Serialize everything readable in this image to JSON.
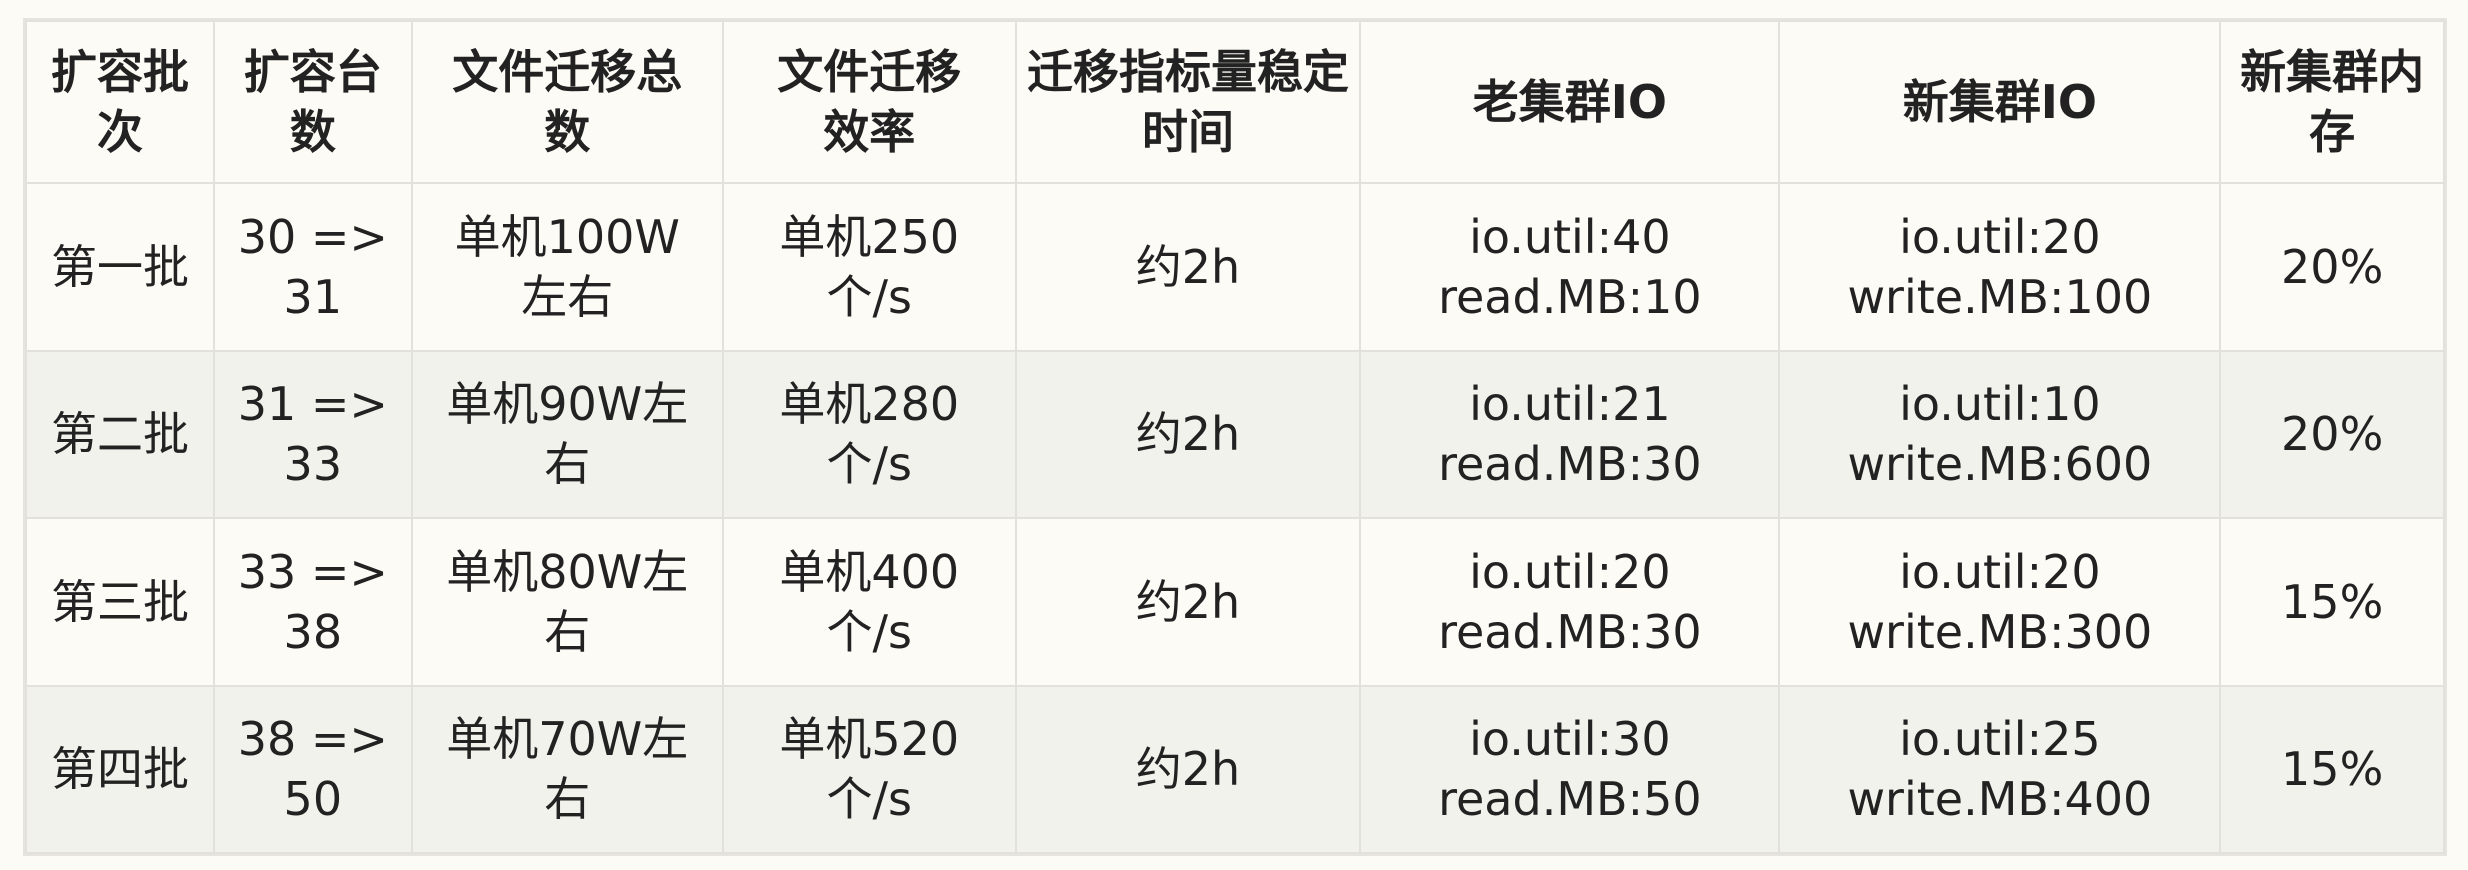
{
  "columns": [
    {
      "label": [
        "扩容批",
        "次"
      ]
    },
    {
      "label": [
        "扩容台",
        "数"
      ]
    },
    {
      "label": [
        "文件迁移总",
        "数"
      ]
    },
    {
      "label": [
        "文件迁移",
        "效率"
      ]
    },
    {
      "label": [
        "迁移指标量稳定",
        "时间"
      ]
    },
    {
      "label": [
        "老集群IO"
      ]
    },
    {
      "label": [
        "新集群IO"
      ]
    },
    {
      "label": [
        "新集群内",
        "存"
      ]
    }
  ],
  "rows": [
    {
      "batch": [
        "第一批"
      ],
      "machines": [
        "30 =>",
        "31"
      ],
      "total": [
        "单机100W",
        "左右"
      ],
      "efficiency": [
        "单机250",
        "个/s"
      ],
      "stable_time": [
        "约2h"
      ],
      "old_io": [
        "io.util:40",
        "read.MB:10"
      ],
      "new_io": [
        "io.util:20",
        "write.MB:100"
      ],
      "memory": [
        "20%"
      ]
    },
    {
      "batch": [
        "第二批"
      ],
      "machines": [
        "31 =>",
        "33"
      ],
      "total": [
        "单机90W左",
        "右"
      ],
      "efficiency": [
        "单机280",
        "个/s"
      ],
      "stable_time": [
        "约2h"
      ],
      "old_io": [
        "io.util:21",
        "read.MB:30"
      ],
      "new_io": [
        "io.util:10",
        "write.MB:600"
      ],
      "memory": [
        "20%"
      ]
    },
    {
      "batch": [
        "第三批"
      ],
      "machines": [
        "33 =>",
        "38"
      ],
      "total": [
        "单机80W左",
        "右"
      ],
      "efficiency": [
        "单机400",
        "个/s"
      ],
      "stable_time": [
        "约2h"
      ],
      "old_io": [
        "io.util:20",
        "read.MB:30"
      ],
      "new_io": [
        "io.util:20",
        "write.MB:300"
      ],
      "memory": [
        "15%"
      ]
    },
    {
      "batch": [
        "第四批"
      ],
      "machines": [
        "38 =>",
        "50"
      ],
      "total": [
        "单机70W左",
        "右"
      ],
      "efficiency": [
        "单机520",
        "个/s"
      ],
      "stable_time": [
        "约2h"
      ],
      "old_io": [
        "io.util:30",
        "read.MB:50"
      ],
      "new_io": [
        "io.util:25",
        "write.MB:400"
      ],
      "memory": [
        "15%"
      ]
    }
  ],
  "colors": {
    "background": "#fdfbf6",
    "alt_row": "#f2f2ec",
    "border": "#e3e1dc",
    "text": "#222222"
  }
}
